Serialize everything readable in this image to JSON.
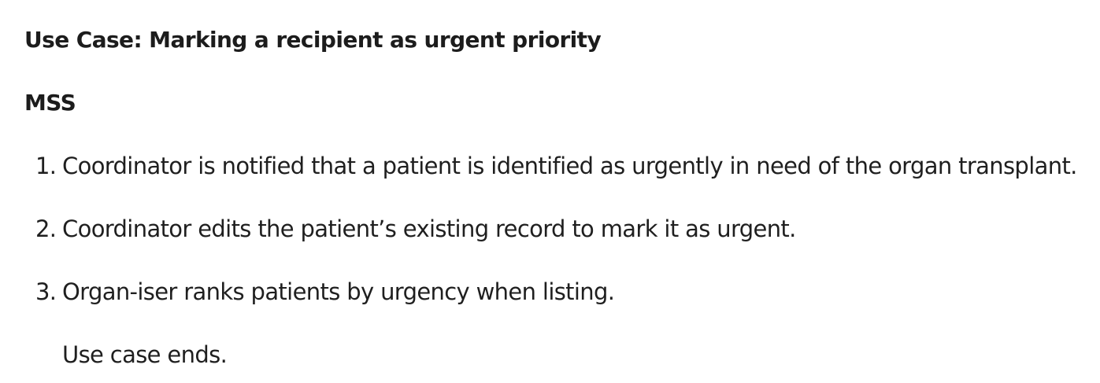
{
  "document": {
    "title": "Use Case: Marking a recipient as urgent priority",
    "section_heading": "MSS",
    "steps": [
      {
        "number": "1.",
        "text": "Coordinator is notified that a patient is identified as urgently in need of the organ transplant."
      },
      {
        "number": "2.",
        "text": "Coordinator edits the patient’s existing record to mark it as urgent."
      },
      {
        "number": "3.",
        "text": "Organ-iser ranks patients by urgency when listing."
      }
    ],
    "closing": "Use case ends."
  }
}
